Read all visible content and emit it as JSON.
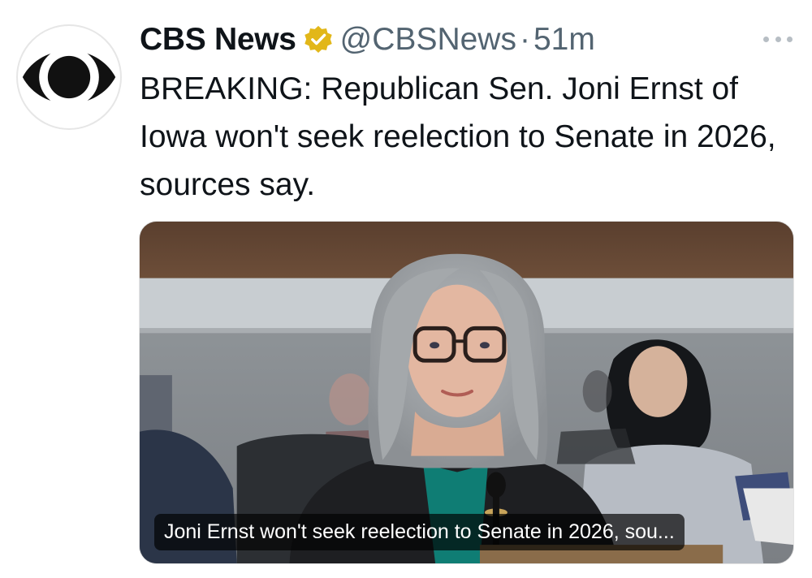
{
  "tweet": {
    "display_name": "CBS News",
    "handle": "@CBSNews",
    "separator": "·",
    "timestamp": "51m",
    "text": "BREAKING: Republican Sen. Joni Ernst of Iowa won't seek reelection to Senate in 2026, sources say.",
    "verified_badge_icon": "verified-gold-badge-icon",
    "avatar_icon": "cbs-eye-logo",
    "more_icon": "more-options-dots-icon",
    "media": {
      "caption": "Joni Ernst won't seek reelection to Senate in 2026, sou..."
    }
  },
  "colors": {
    "text_primary": "#0f1419",
    "text_secondary": "#536471",
    "verified_gold": "#e2b719",
    "caption_bg": "rgba(0,0,0,0.68)"
  }
}
